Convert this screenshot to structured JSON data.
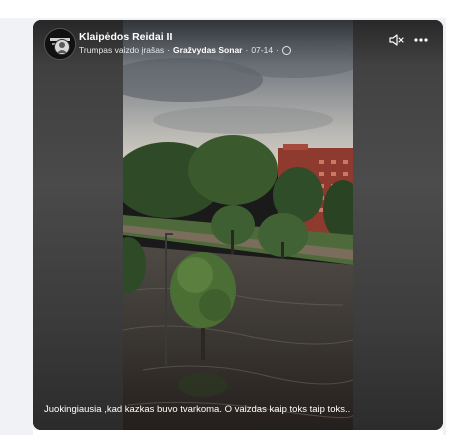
{
  "post": {
    "page_name": "Klaipėdos Reidai II",
    "post_type": "Trumpas vaizdo įrašas",
    "separator": "·",
    "author": "Gražvydas Sonar",
    "date": "07-14",
    "audience_icon": "globe-icon",
    "caption": "Juokingiausia ,kad kazkas buvo tvarkoma. O vaizdas kaip toks taip toks.."
  },
  "controls": {
    "mute_icon": "speaker-muted-icon",
    "more_icon": "more-dots-icon"
  },
  "colors": {
    "card_background": "#1a1a1a",
    "text": "#ffffff",
    "page_background": "#f0f2f5"
  }
}
